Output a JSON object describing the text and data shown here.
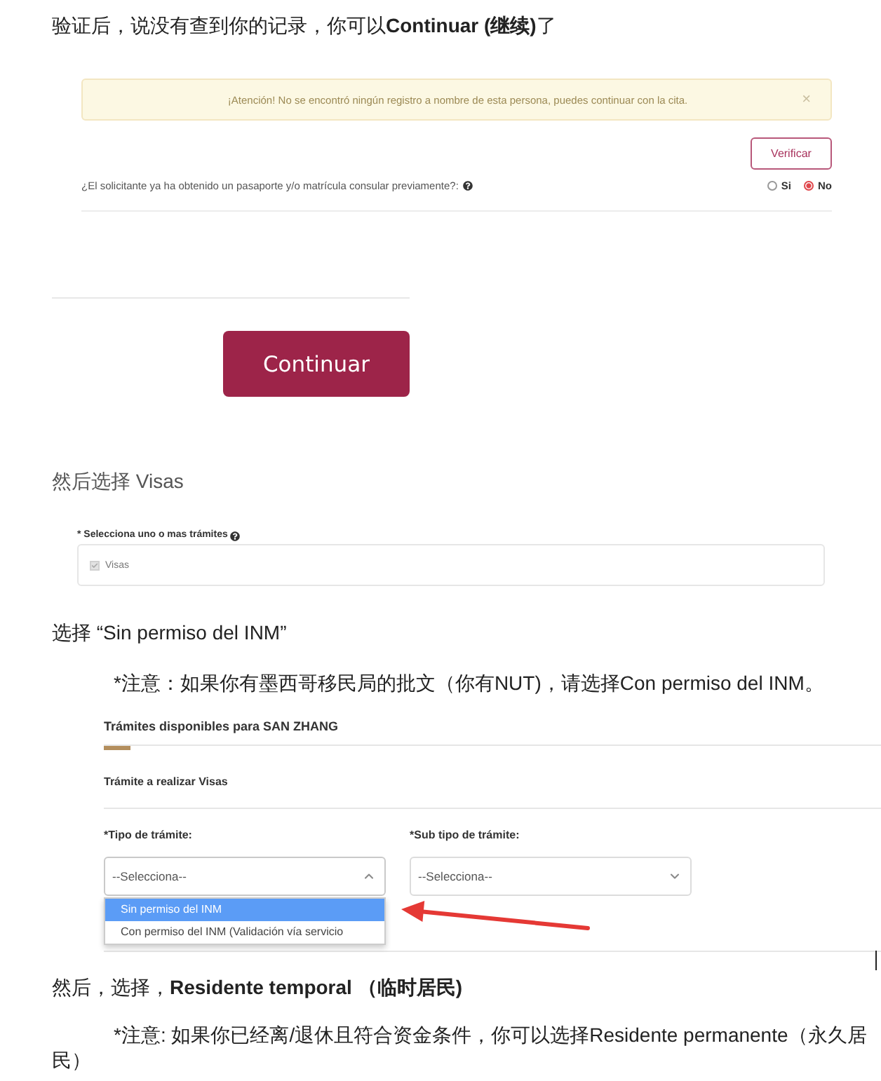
{
  "intro_text": "验证后，说没有查到你的记录，你可以**Continuar (继续)**了",
  "verification_panel": {
    "alert": {
      "message": "¡Atención! No se encontró ningún registro a nombre de esta persona, puedes continuar con la cita.",
      "close": "×"
    },
    "verify_button": "Verificar",
    "question": {
      "text": "¿El solicitante ya ha obtenido un pasaporte y/o matrícula consular previamente?:",
      "options": [
        {
          "label": "Si",
          "selected": false
        },
        {
          "label": "No",
          "selected": true
        }
      ]
    }
  },
  "continue_button": "Continuar",
  "visas_step_text": "然后选择 Visas",
  "procedures_panel": {
    "label": "* Selecciona uno o mas trámites",
    "options": [
      {
        "label": "Visas",
        "checked": true
      }
    ]
  },
  "sin_permiso_step_text": "选择 “Sin permiso del INM”",
  "nut_note": "*注意：如果你有墨西哥移民局的批文（你有NUT)，请选择Con permiso del INM。",
  "procedure_type_panel": {
    "title": "Trámites disponibles para SAN ZHANG",
    "subtitle": "Trámite a realizar Visas",
    "fields": [
      {
        "label": "*Tipo de trámite:",
        "value": "--Selecciona--",
        "expanded": true,
        "options": [
          {
            "label": "Sin permiso del INM",
            "selected": true
          },
          {
            "label": "Con permiso del INM (Validación vía servicio",
            "selected": false
          }
        ]
      },
      {
        "label": "*Sub tipo de trámite:",
        "value": "--Selecciona--",
        "expanded": false
      }
    ]
  },
  "residente_step_text": "然后，选择，**Residente temporal （临时居民)**",
  "retiree_note": "*注意: 如果你已经离/退休且符合资金条件，你可以选择Residente permanente（永久居民）"
}
